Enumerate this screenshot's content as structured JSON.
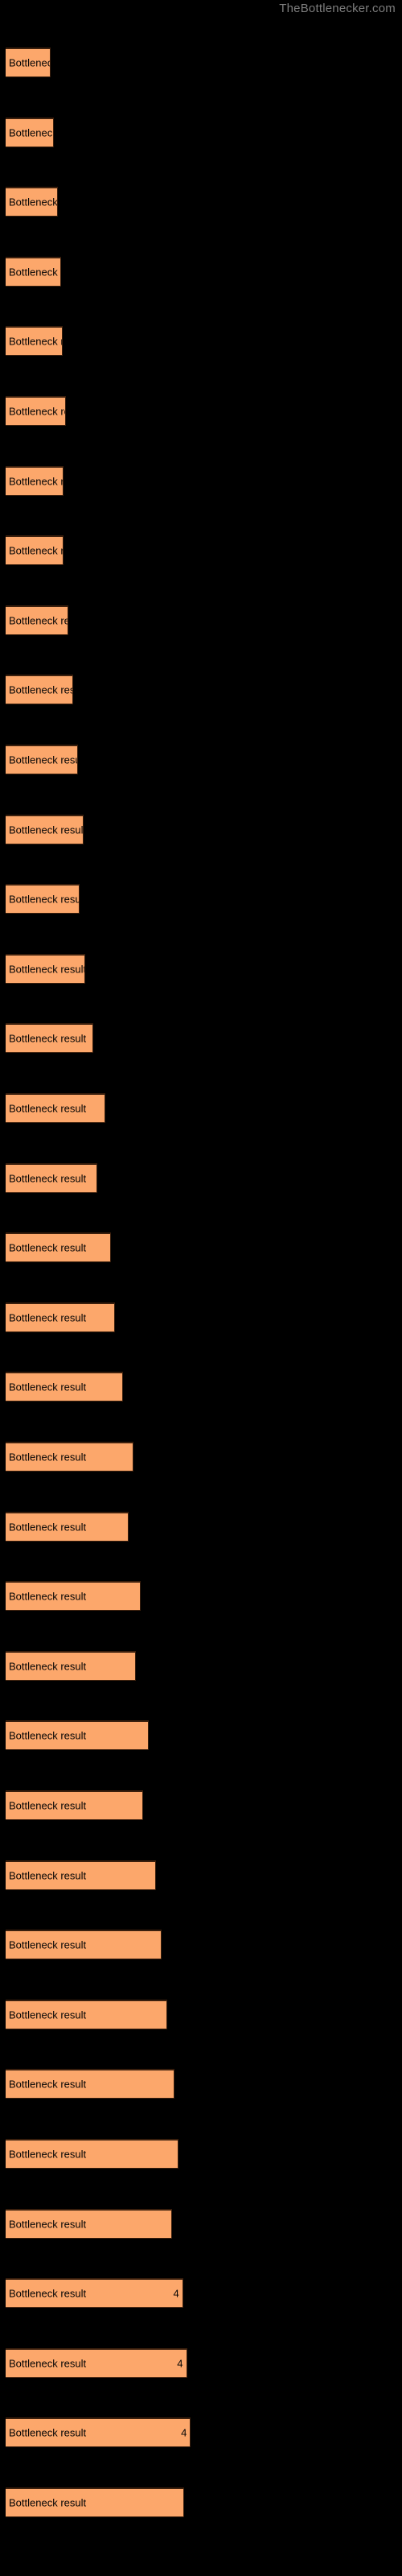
{
  "site": {
    "title": "TheBottlenecker.com",
    "title_color": "#7d7d7d"
  },
  "chart_style": {
    "background": "#000000",
    "bar_fill": "#fca76b",
    "bar_border": "#3a1f0d",
    "label_color": "#050505"
  },
  "chart_data": {
    "type": "bar",
    "orientation": "horizontal",
    "title": "",
    "subtitle": "",
    "xlabel": "",
    "ylabel": "",
    "grid": false,
    "legend": null,
    "xlim": [
      0,
      100
    ],
    "bar_label_text": "Bottleneck result",
    "categories": [
      "Bottleneck result",
      "Bottleneck result",
      "Bottleneck result",
      "Bottleneck result",
      "Bottleneck result",
      "Bottleneck result",
      "Bottleneck result",
      "Bottleneck result",
      "Bottleneck result",
      "Bottleneck result",
      "Bottleneck result",
      "Bottleneck result",
      "Bottleneck result",
      "Bottleneck result",
      "Bottleneck result",
      "Bottleneck result",
      "Bottleneck result",
      "Bottleneck result",
      "Bottleneck result",
      "Bottleneck result",
      "Bottleneck result",
      "Bottleneck result",
      "Bottleneck result",
      "Bottleneck result",
      "Bottleneck result",
      "Bottleneck result",
      "Bottleneck result",
      "Bottleneck result",
      "Bottleneck result",
      "Bottleneck result",
      "Bottleneck result",
      "Bottleneck result",
      "Bottleneck result",
      "Bottleneck result",
      "Bottleneck result",
      "Bottleneck result"
    ],
    "values": [
      11.5,
      12.4,
      13.3,
      14.2,
      14.6,
      15.5,
      14.8,
      14.9,
      16.0,
      17.3,
      18.6,
      20.0,
      18.9,
      20.4,
      22.5,
      25.5,
      23.6,
      27.0,
      28.0,
      30.0,
      32.8,
      31.5,
      34.6,
      33.4,
      36.8,
      35.2,
      38.5,
      40.0,
      41.4,
      43.2,
      44.4,
      42.6,
      45.5,
      46.5,
      47.5,
      45.8
    ],
    "value_labels": [
      "",
      "",
      "",
      "",
      "",
      "",
      "",
      "",
      "",
      "",
      "",
      "",
      "",
      "",
      "",
      "",
      "",
      "",
      "",
      "",
      "",
      "",
      "",
      "",
      "",
      "",
      "",
      "",
      "",
      "",
      "",
      "",
      "4",
      "4",
      "4",
      ""
    ]
  }
}
